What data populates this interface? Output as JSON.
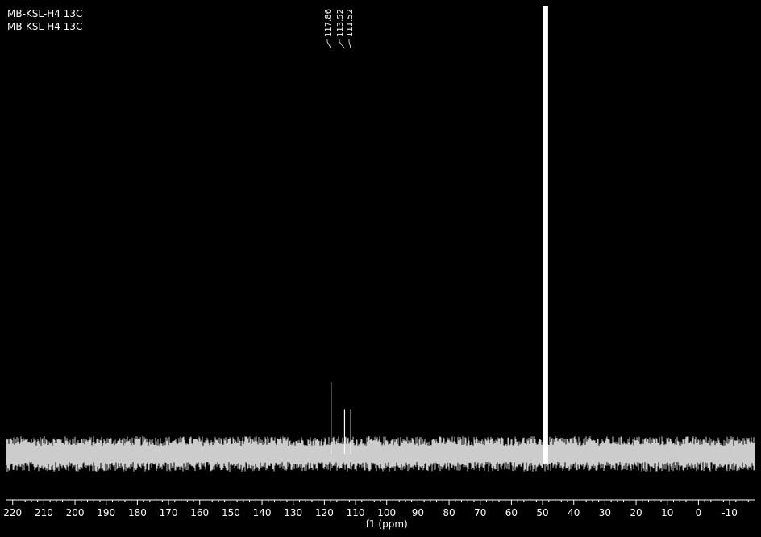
{
  "title_lines": [
    "MB-KSL-H4 13C",
    "MB-KSL-H4 13C"
  ],
  "chart_data": {
    "type": "line",
    "title": "MB-KSL-H4 13C",
    "xlabel": "f1 (ppm)",
    "ylabel": "",
    "x_reversed": true,
    "xlim": [
      222,
      -18
    ],
    "xticks": [
      220,
      210,
      200,
      190,
      180,
      170,
      160,
      150,
      140,
      130,
      120,
      110,
      100,
      90,
      80,
      70,
      60,
      50,
      40,
      30,
      20,
      10,
      0,
      -10
    ],
    "grid": false,
    "peak_labels": [
      "117.86",
      "113.52",
      "111.52"
    ],
    "peaks": [
      {
        "ppm": 117.86,
        "height": 0.16
      },
      {
        "ppm": 113.52,
        "height": 0.1
      },
      {
        "ppm": 111.52,
        "height": 0.1
      },
      {
        "ppm": 49.0,
        "height": 1.0
      }
    ],
    "baseline_noise": "dense noise band along baseline",
    "colors": {
      "background": "#000000",
      "trace": "#ffffff"
    }
  }
}
